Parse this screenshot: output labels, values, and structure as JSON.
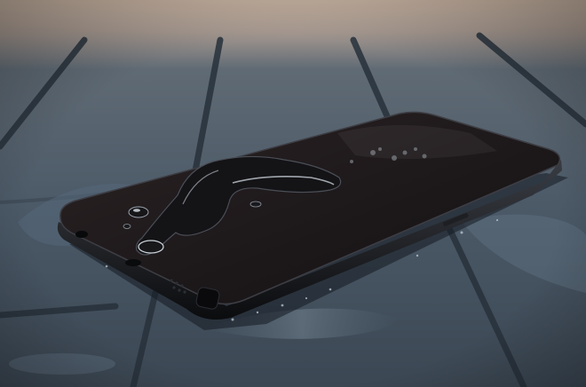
{
  "colors": {
    "background_top": "#c9b7a6",
    "surface": "#4a5866",
    "surface_dark": "#2f3944",
    "groove": "#25303a",
    "phone_body": "#121315",
    "phone_screen": "#1d1a1b",
    "water_highlight": "#dfe7ee"
  },
  "icons": {
    "phone": "smartphone-icon",
    "water": "water-drop-icon"
  }
}
